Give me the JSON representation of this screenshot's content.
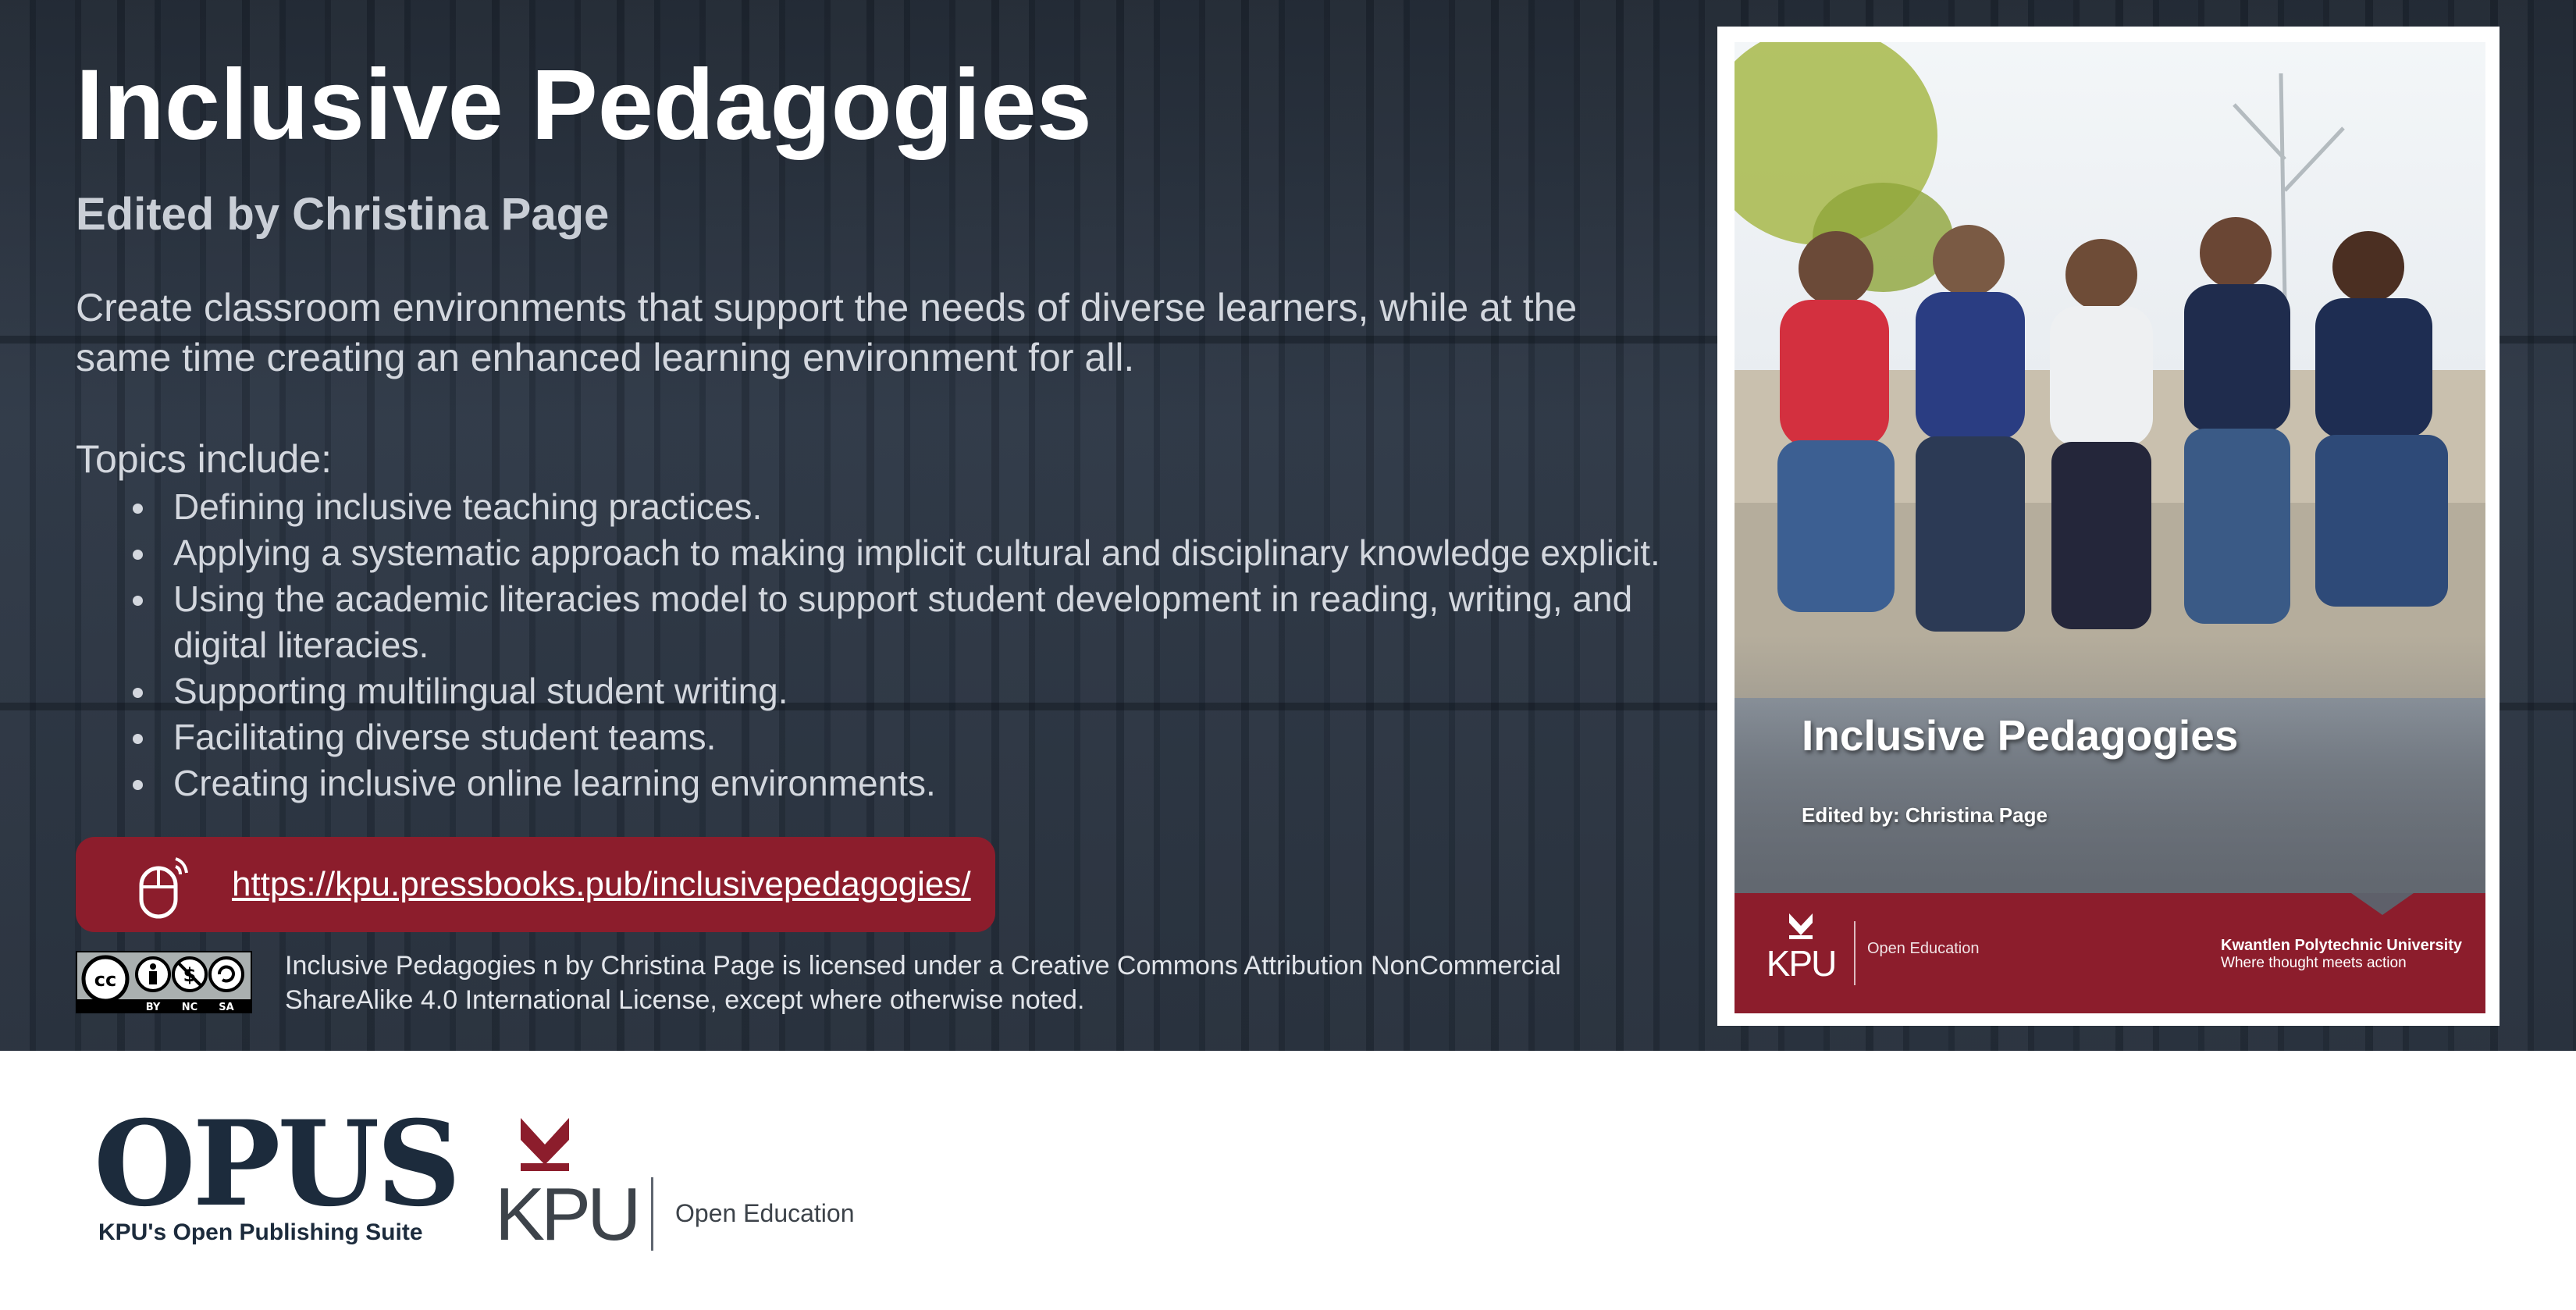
{
  "hero": {
    "title": "Inclusive Pedagogies",
    "editor": "Edited by Christina Page",
    "description": "Create classroom environments that support the needs of diverse learners, while at the same time creating an enhanced learning environment for all.",
    "topics_label": "Topics include:",
    "topics": [
      "Defining inclusive teaching practices.",
      "Applying a systematic approach to making implicit cultural and disciplinary knowledge explicit.",
      "Using the academic literacies model to support student development in reading, writing, and digital literacies.",
      "Supporting multilingual student writing.",
      "Facilitating diverse student teams.",
      "Creating inclusive online learning environments."
    ],
    "link": "https://kpu.pressbooks.pub/inclusivepedagogies/",
    "license_text": "Inclusive Pedagogies n by Christina Page is licensed under a Creative Commons Attribution NonCommercial ShareAlike 4.0 International License, except where otherwise noted.",
    "license_badge": {
      "icon": "cc-by-nc-sa-icon",
      "labels": [
        "BY",
        "NC",
        "SA"
      ]
    }
  },
  "cover": {
    "title": "Inclusive Pedagogies",
    "editor": "Edited by: Christina Page",
    "brand": "KPU",
    "brand_tag": "Open Education",
    "university": "Kwantlen Polytechnic University",
    "tagline": "Where thought meets action"
  },
  "footer": {
    "opus": "OPUS",
    "opus_sub": "KPU's Open Publishing Suite",
    "kpu": "KPU",
    "kpu_tag": "Open Education"
  },
  "colors": {
    "hero_bg": "#2c3644",
    "accent": "#8c1d2c",
    "navy": "#1c2b3c",
    "text_light": "#d3d7de"
  }
}
